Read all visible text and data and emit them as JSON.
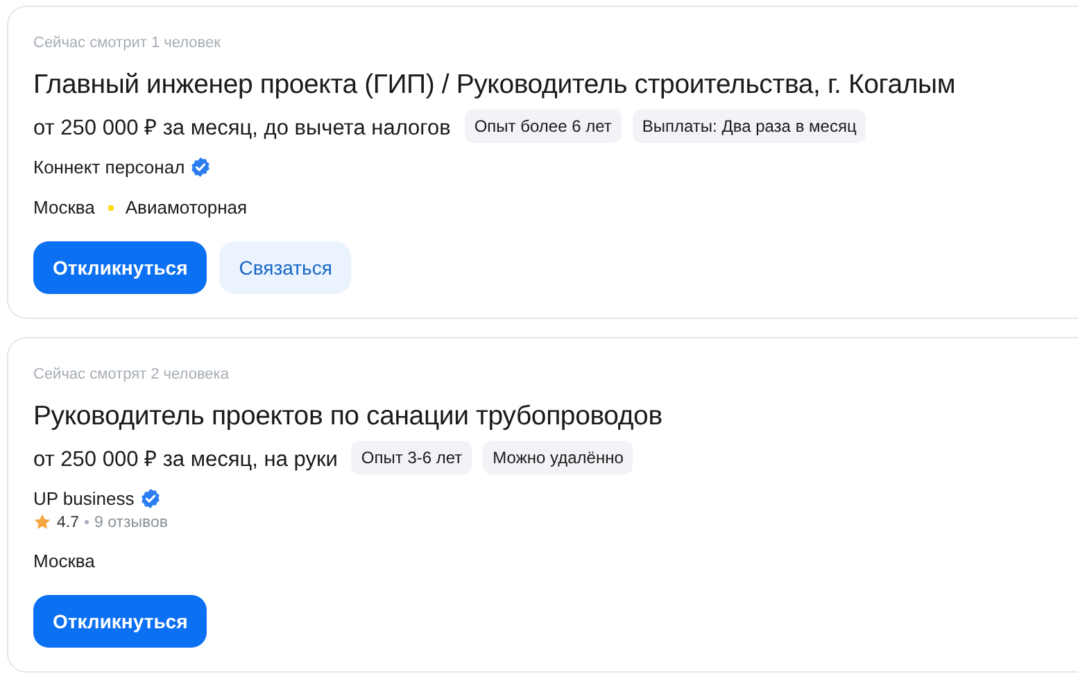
{
  "vacancies": [
    {
      "viewers": "Сейчас смотрит 1 человек",
      "title": "Главный инженер проекта (ГИП) / Руководитель строительства, г. Когалым",
      "salary": "от 250 000 ₽ за месяц, до вычета налогов",
      "tags": [
        "Опыт более 6 лет",
        "Выплаты: Два раза в месяц"
      ],
      "company": "Коннект персонал",
      "verified": true,
      "city": "Москва",
      "metro": {
        "name": "Авиамоторная",
        "color": "#ffd800"
      },
      "buttons": [
        {
          "label": "Откликнуться",
          "kind": "primary"
        },
        {
          "label": "Связаться",
          "kind": "secondary"
        }
      ]
    },
    {
      "viewers": "Сейчас смотрят 2 человека",
      "title": "Руководитель проектов по санации трубопроводов",
      "salary": "от 250 000 ₽ за месяц, на руки",
      "tags": [
        "Опыт 3-6 лет",
        "Можно удалённо"
      ],
      "company": "UP business",
      "verified": true,
      "rating": {
        "score": "4.7",
        "reviews": "9 отзывов"
      },
      "city": "Москва",
      "buttons": [
        {
          "label": "Откликнуться",
          "kind": "primary"
        }
      ]
    }
  ]
}
